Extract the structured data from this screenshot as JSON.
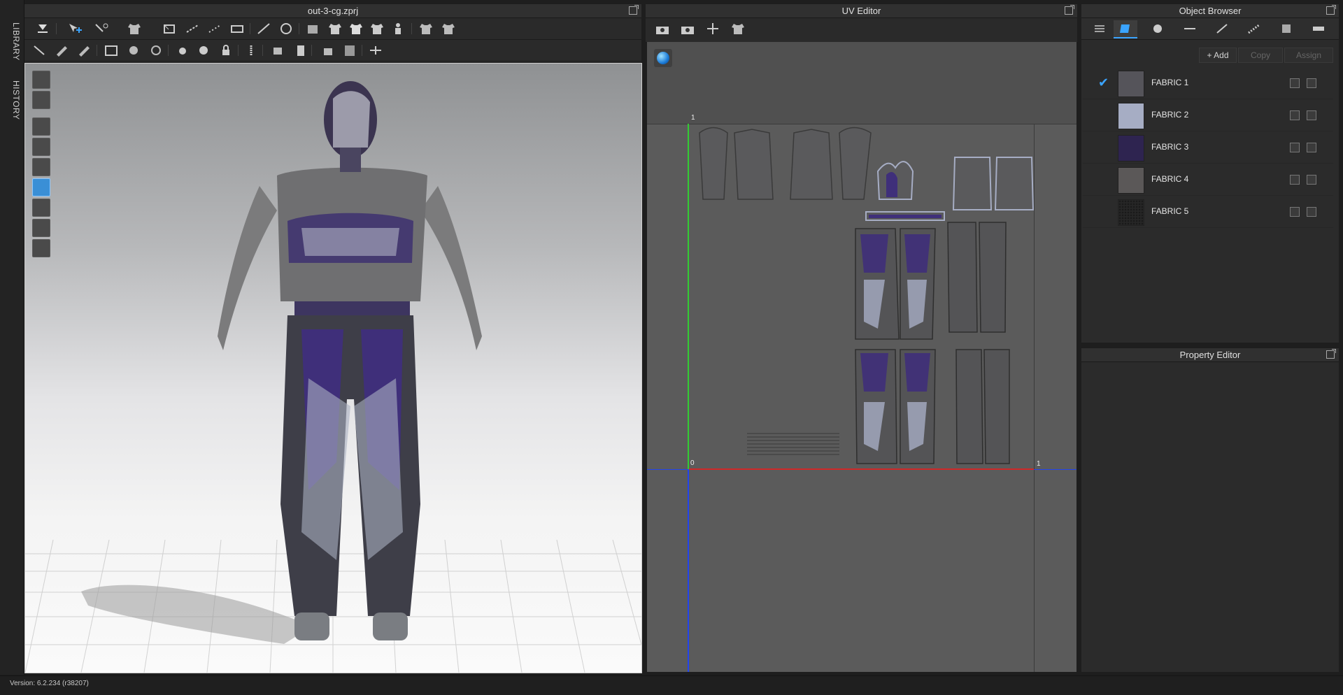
{
  "left_strip": {
    "library": "LIBRARY",
    "history": "HISTORY"
  },
  "viewport": {
    "title": "out-3-cg.zprj"
  },
  "uv_editor": {
    "title": "UV Editor",
    "axis_origin": "0",
    "axis_top": "1",
    "axis_right": "1"
  },
  "object_browser": {
    "title": "Object Browser",
    "add_label": "+ Add",
    "copy_label": "Copy",
    "assign_label": "Assign",
    "fabrics": [
      {
        "name": "FABRIC 1",
        "color": "#55545a",
        "selected": true
      },
      {
        "name": "FABRIC 2",
        "color": "#a6adc4",
        "selected": false
      },
      {
        "name": "FABRIC 3",
        "color": "#2e2450",
        "selected": false
      },
      {
        "name": "FABRIC 4",
        "color": "#5b5858",
        "selected": false
      },
      {
        "name": "FABRIC 5",
        "color": "#262626",
        "selected": false
      }
    ]
  },
  "property_editor": {
    "title": "Property Editor"
  },
  "status": {
    "version": "Version: 6.2.234 (r38207)"
  },
  "colors": {
    "accent": "#3aa4ff",
    "panel": "#2b2b2b",
    "uv_bg": "#5b5b5b"
  }
}
